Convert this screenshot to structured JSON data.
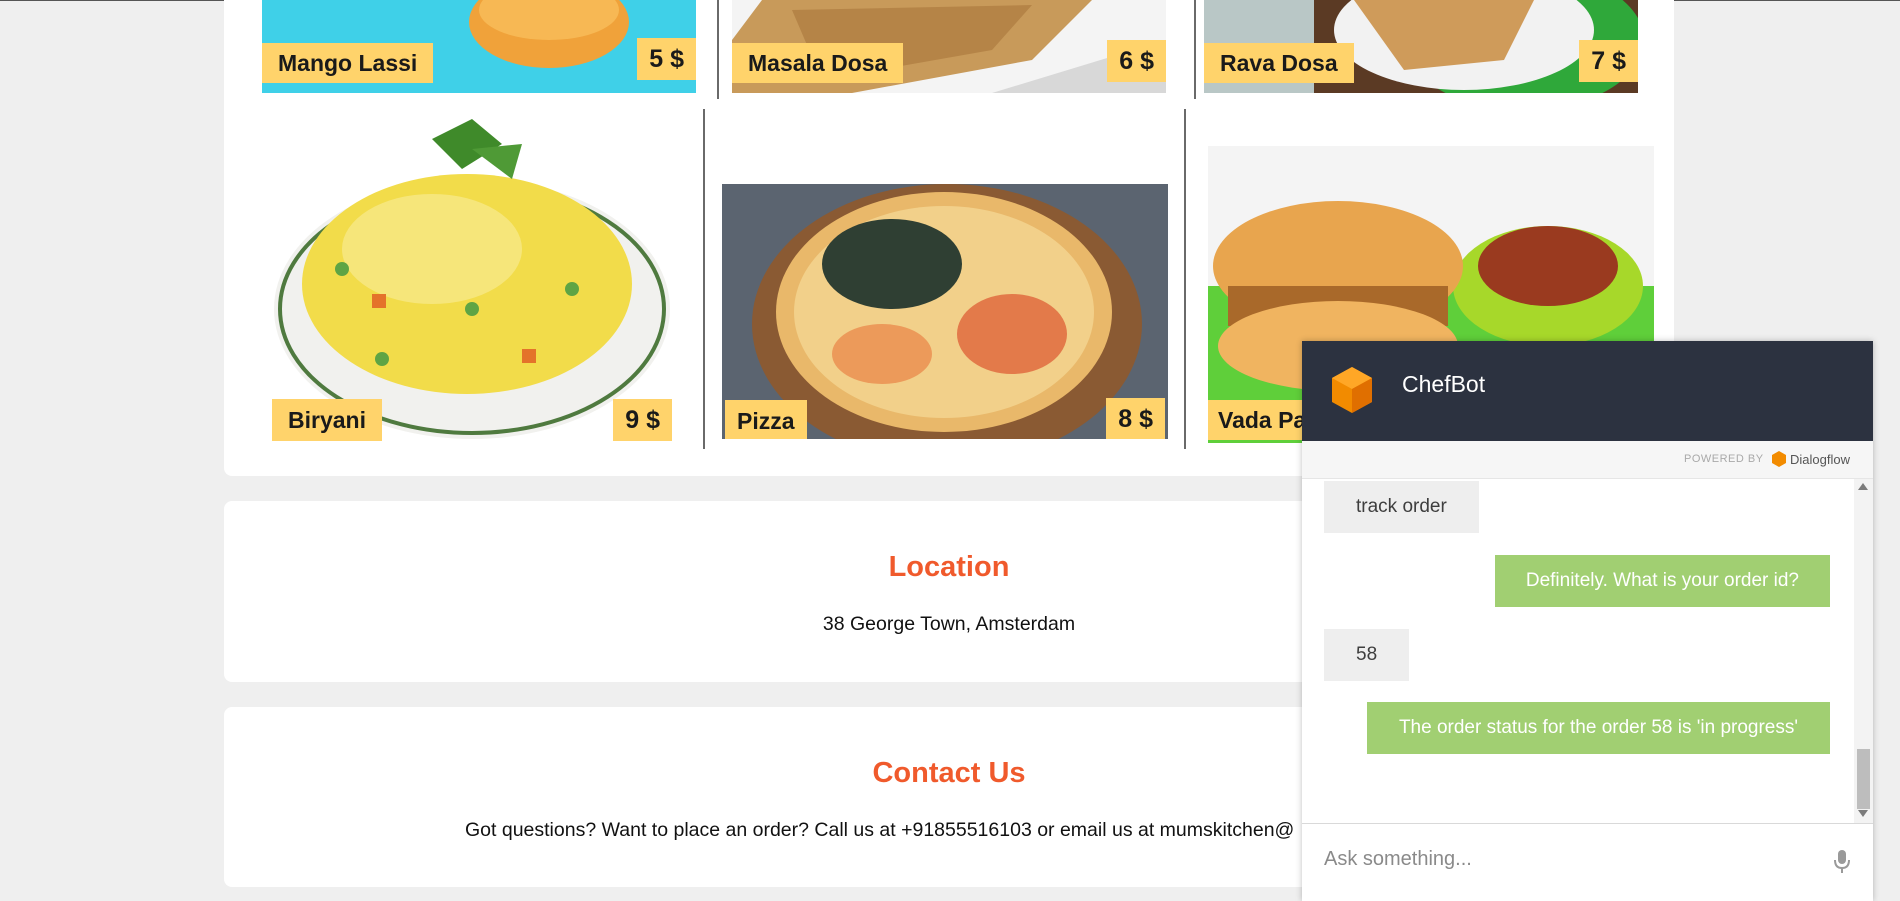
{
  "menu": {
    "items": [
      {
        "name": "Mango Lassi",
        "price": "5 $"
      },
      {
        "name": "Masala Dosa",
        "price": "6 $"
      },
      {
        "name": "Rava Dosa",
        "price": "7 $"
      },
      {
        "name": "Biryani",
        "price": "9 $"
      },
      {
        "name": "Pizza",
        "price": "8 $"
      },
      {
        "name": "Vada Pav",
        "price": ""
      }
    ]
  },
  "location": {
    "title": "Location",
    "address": "38 George Town, Amsterdam"
  },
  "contact": {
    "title": "Contact Us",
    "text": "Got questions? Want to place an order? Call us at +91855516103 or email us at mumskitchen@"
  },
  "chatbot": {
    "title": "ChefBot",
    "powered_by": "POWERED BY",
    "brand": "Dialogflow",
    "messages": [
      {
        "from": "user",
        "text": "track order"
      },
      {
        "from": "bot",
        "text": "Definitely. What is your order id?"
      },
      {
        "from": "user",
        "text": "58"
      },
      {
        "from": "bot",
        "text": "The order status for the order 58 is 'in progress'"
      }
    ],
    "input_placeholder": "Ask something...",
    "icons": {
      "logo": "dialogflow-logo-icon",
      "mic": "microphone-icon"
    }
  },
  "colors": {
    "accent": "#f05a2c",
    "tag": "#ffd36b",
    "chat_header": "#2c3240",
    "bot_bubble": "#a1cf72",
    "user_bubble": "#eeeeee"
  },
  "page_label": "Vada Pa"
}
